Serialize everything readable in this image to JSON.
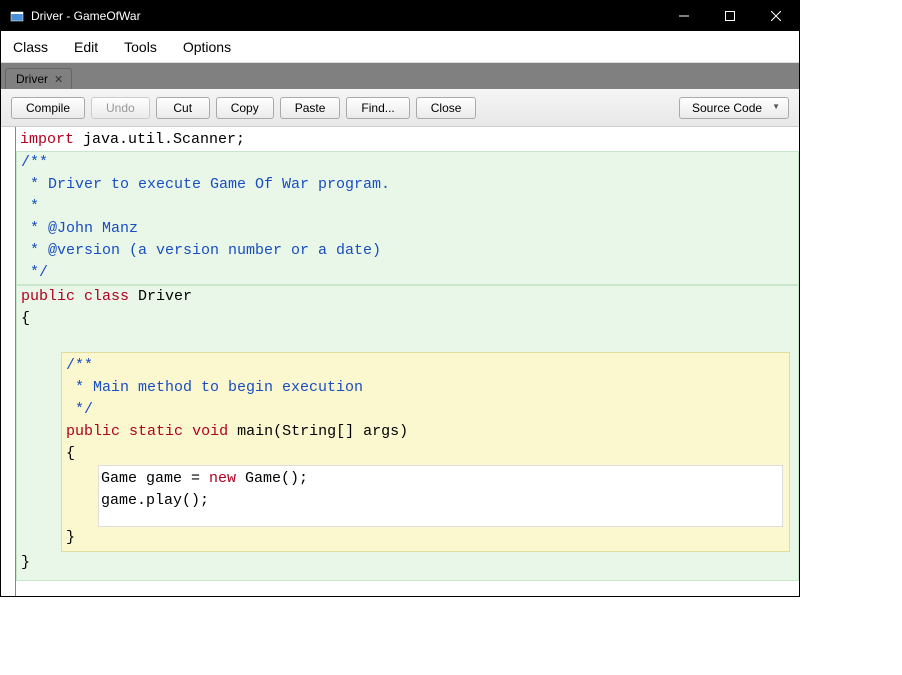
{
  "titlebar": {
    "text": "Driver - GameOfWar"
  },
  "menubar": {
    "items": [
      "Class",
      "Edit",
      "Tools",
      "Options"
    ]
  },
  "tab": {
    "label": "Driver"
  },
  "toolbar": {
    "compile": "Compile",
    "undo": "Undo",
    "cut": "Cut",
    "copy": "Copy",
    "paste": "Paste",
    "find": "Find...",
    "close": "Close",
    "view": "Source Code"
  },
  "code": {
    "import": "import",
    "import_pkg": " java.util.Scanner;",
    "doc_open": "/**",
    "doc_l1": " * Driver to execute Game Of War program.",
    "doc_l2": " *",
    "doc_l3": " * @John Manz",
    "doc_l4": " * @version (a version number or a date)",
    "doc_close": " */",
    "public": "public",
    "class": "class",
    "classname": " Driver",
    "obrace": "{",
    "cbrace": "}",
    "mdoc_open": "/**",
    "mdoc_l1": " * Main method to begin execution",
    "mdoc_close": " */",
    "static": "static",
    "void": "void",
    "main_sig": " main(String[] args)",
    "body_l1": "Game game = ",
    "new": "new",
    "body_l1b": " Game();",
    "body_l2": "game.play();"
  }
}
